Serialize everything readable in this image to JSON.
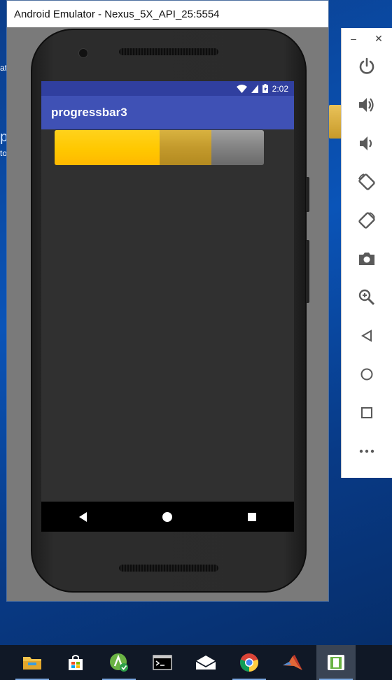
{
  "window": {
    "title": "Android Emulator - Nexus_5X_API_25:5554"
  },
  "status_bar": {
    "time": "2:02"
  },
  "app": {
    "title": "progressbar3"
  },
  "progress": {
    "primary_fraction": 0.5,
    "secondary_fraction": 0.75
  },
  "colors": {
    "status_bar": "#303f9f",
    "app_bar": "#3f51b5",
    "progress_primary": "#ffc800"
  },
  "desktop_fragments": [
    "at",
    "p",
    "to"
  ],
  "toolbar": {
    "icons": [
      "power-icon",
      "volume-up-icon",
      "volume-down-icon",
      "rotate-left-icon",
      "rotate-right-icon",
      "camera-icon",
      "zoom-icon",
      "back-icon",
      "home-icon",
      "overview-icon",
      "more-icon"
    ]
  },
  "taskbar": {
    "icons": [
      "file-explorer-icon",
      "store-icon",
      "android-studio-icon",
      "terminal-icon",
      "mail-icon",
      "chrome-icon",
      "matlab-icon",
      "emulator-icon"
    ]
  }
}
